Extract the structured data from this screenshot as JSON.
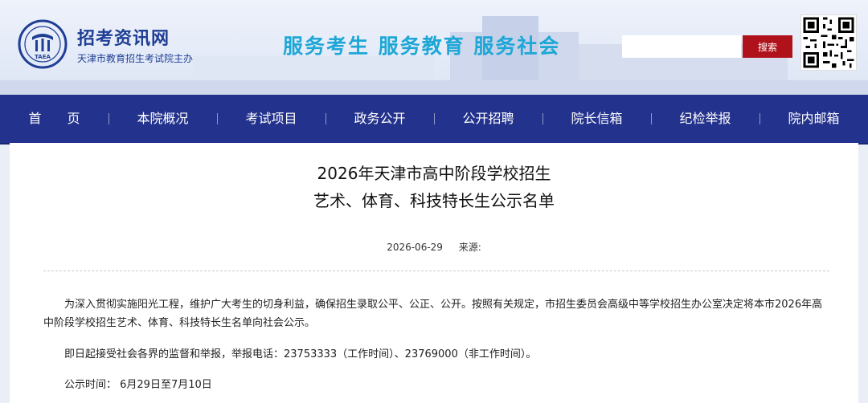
{
  "header": {
    "logo_text": "TAEA",
    "site_title": "招考资讯网",
    "site_subtitle": "天津市教育招生考试院主办",
    "slogan": "服务考生  服务教育  服务社会",
    "search": {
      "placeholder": "",
      "button_label": "搜索"
    }
  },
  "nav": {
    "items": [
      {
        "label": "首　　页"
      },
      {
        "label": "本院概况"
      },
      {
        "label": "考试项目"
      },
      {
        "label": "政务公开"
      },
      {
        "label": "公开招聘"
      },
      {
        "label": "院长信箱"
      },
      {
        "label": "纪检举报"
      },
      {
        "label": "院内邮箱"
      }
    ]
  },
  "article": {
    "title_line1": "2026年天津市高中阶段学校招生",
    "title_line2": "艺术、体育、科技特长生公示名单",
    "date": "2026-06-29",
    "source_label": "来源:",
    "paragraphs": [
      "为深入贯彻实施阳光工程，维护广大考生的切身利益，确保招生录取公平、公正、公开。按照有关规定，市招生委员会高级中等学校招生办公室决定将本市2026年高中阶段学校招生艺术、体育、科技特长生名单向社会公示。",
      "即日起接受社会各界的监督和举报，举报电话：23753333（工作时间）、23769000（非工作时间）。",
      "公示时间：  6月29日至7月10日"
    ]
  },
  "colors": {
    "nav_bg": "#23328c",
    "brand_blue": "#1f3f95",
    "slogan": "#1ea7d6",
    "search_button": "#b0121b"
  }
}
